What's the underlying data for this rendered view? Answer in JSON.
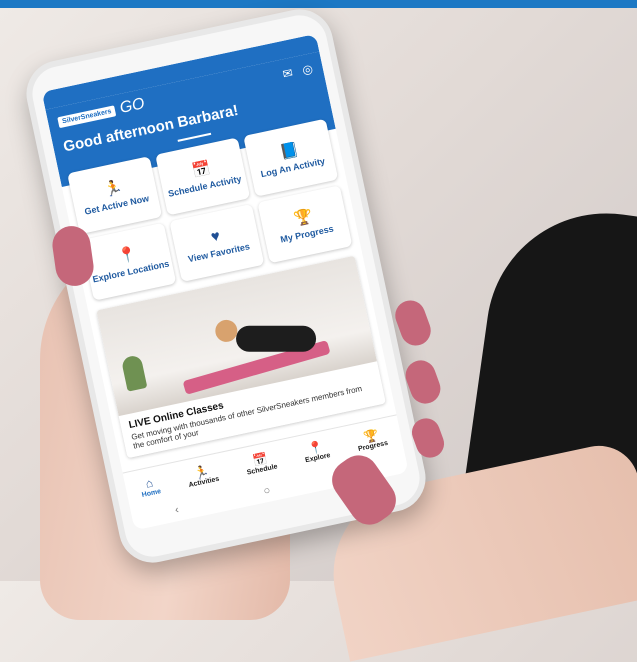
{
  "app": {
    "brand_badge": "SilverSneakers",
    "brand_suffix": "GO",
    "greeting": "Good afternoon Barbara!"
  },
  "icons": {
    "mail": "mail-icon",
    "profile": "profile-icon"
  },
  "tiles": [
    {
      "label": "Get Active Now",
      "icon": "running-person-icon",
      "glyph": "🏃"
    },
    {
      "label": "Schedule Activity",
      "icon": "calendar-icon",
      "glyph": "📅"
    },
    {
      "label": "Log An Activity",
      "icon": "book-icon",
      "glyph": "📘"
    },
    {
      "label": "Explore Locations",
      "icon": "location-pin-icon",
      "glyph": "📍"
    },
    {
      "label": "View Favorites",
      "icon": "heart-icon",
      "glyph": "♥"
    },
    {
      "label": "My Progress",
      "icon": "trophy-icon",
      "glyph": "🏆"
    }
  ],
  "promo": {
    "title": "LIVE Online Classes",
    "description": "Get moving with thousands of other SilverSneakers members from the comfort of your"
  },
  "bottom_nav": [
    {
      "label": "Home",
      "icon": "home-icon",
      "glyph": "⌂",
      "active": true
    },
    {
      "label": "Activities",
      "icon": "running-person-icon",
      "glyph": "🏃"
    },
    {
      "label": "Schedule",
      "icon": "calendar-icon",
      "glyph": "📅"
    },
    {
      "label": "Explore",
      "icon": "location-pin-icon",
      "glyph": "📍"
    },
    {
      "label": "Progress",
      "icon": "trophy-icon",
      "glyph": "🏆"
    }
  ],
  "system_nav": {
    "back": "‹",
    "home": "○",
    "recents": "|||"
  },
  "colors": {
    "brand_blue": "#1f6fc2",
    "nail_pink": "#c5677a"
  }
}
